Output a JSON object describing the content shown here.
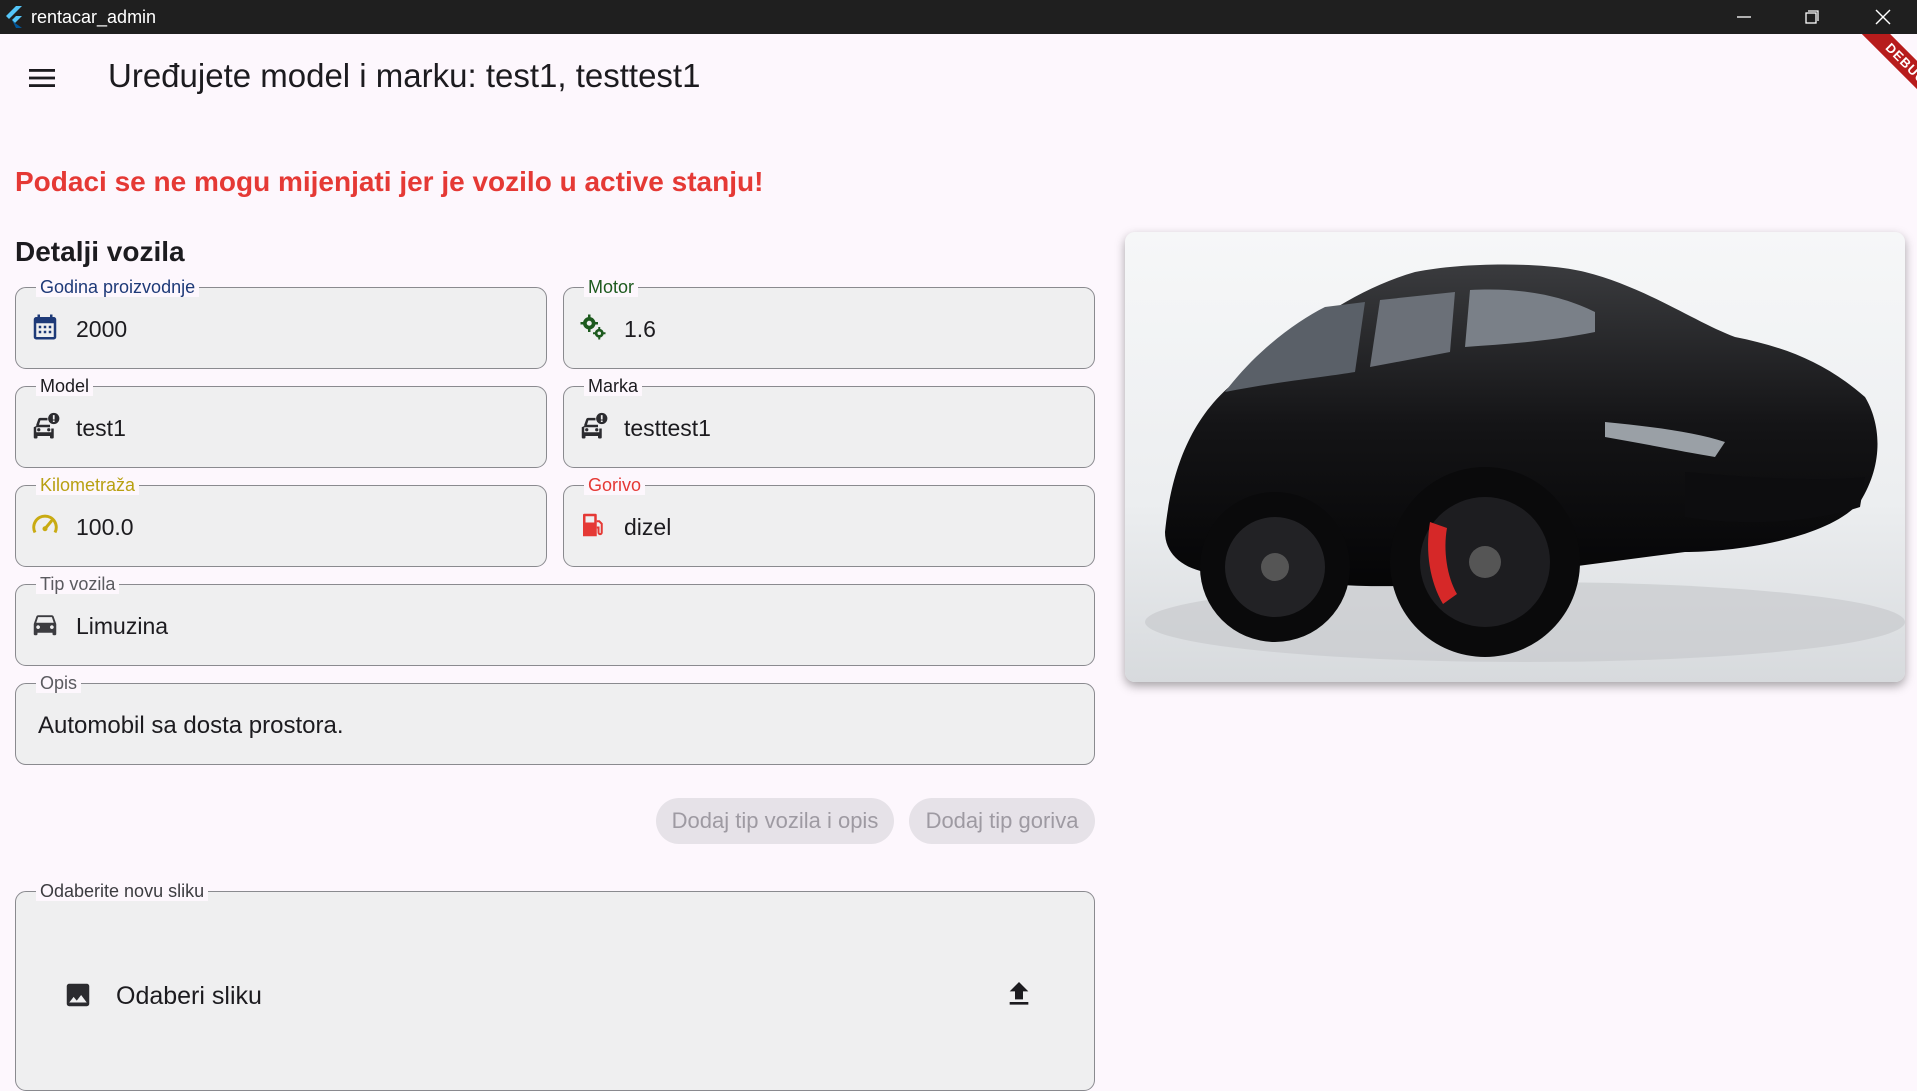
{
  "window": {
    "title": "rentacar_admin"
  },
  "appbar": {
    "title": "Uređujete model i marku: test1, testtest1"
  },
  "debug_banner": "DEBUG",
  "warning": "Podaci se ne mogu mijenjati jer je vozilo u active stanju!",
  "section_title": "Detalji vozila",
  "fields": {
    "godina": {
      "label": "Godina proizvodnje",
      "value": "2000",
      "icon": "calendar-icon",
      "label_color": "#1e3a78",
      "icon_color": "#1e3a78"
    },
    "motor": {
      "label": "Motor",
      "value": "1.6",
      "icon": "gears-icon",
      "label_color": "#1d5a1e",
      "icon_color": "#1d5a1e"
    },
    "model": {
      "label": "Model",
      "value": "test1",
      "icon": "car-alert-icon",
      "label_color": "#1c1b1f",
      "icon_color": "#2b2b2f"
    },
    "marka": {
      "label": "Marka",
      "value": "testtest1",
      "icon": "car-alert-icon",
      "label_color": "#1c1b1f",
      "icon_color": "#2b2b2f"
    },
    "kilometraza": {
      "label": "Kilometraža",
      "value": "100.0",
      "icon": "speedometer-icon",
      "label_color": "#b8a012",
      "icon_color": "#c9ab12"
    },
    "gorivo": {
      "label": "Gorivo",
      "value": "dizel",
      "icon": "fuel-icon",
      "label_color": "#e53935",
      "icon_color": "#e53935"
    },
    "tip_vozila": {
      "label": "Tip vozila",
      "value": "Limuzina",
      "icon": "car-icon",
      "label_color": "#5a5a5f",
      "icon_color": "#3c3c40"
    },
    "opis": {
      "label": "Opis",
      "value": "Automobil sa dosta prostora.",
      "label_color": "#5a5a5f"
    }
  },
  "buttons": {
    "add_type_desc": "Dodaj tip vozila i opis",
    "add_fuel": "Dodaj tip goriva"
  },
  "upload": {
    "label": "Odaberite novu sliku",
    "pick_label": "Odaberi sliku",
    "icons": [
      "image-icon",
      "upload-icon"
    ]
  },
  "colors": {
    "background": "#fdf7fd",
    "titlebar": "#1f1f1f",
    "warning": "#e53935",
    "field_fill": "#efeff0",
    "field_border": "#8a8a8f",
    "button_disabled_bg": "#e6e2e8",
    "button_disabled_text": "#9e9aa2"
  }
}
